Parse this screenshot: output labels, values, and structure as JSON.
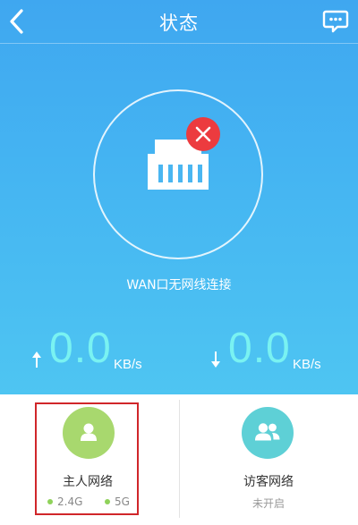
{
  "header": {
    "title": "状态",
    "back_icon": "chevron-left-icon",
    "message_icon": "chat-bubble-icon"
  },
  "wan": {
    "status_text": "WAN口无网线连接",
    "icon": "ethernet-port-icon",
    "badge_icon": "close-icon",
    "badge_color": "#ec3b3f"
  },
  "speeds": {
    "upload": {
      "value": "0.0",
      "unit": "KB/s",
      "icon": "arrow-up-icon"
    },
    "download": {
      "value": "0.0",
      "unit": "KB/s",
      "icon": "arrow-down-icon"
    }
  },
  "networks": {
    "host": {
      "title": "主人网络",
      "icon": "user-icon",
      "bands": [
        "2.4G",
        "5G"
      ],
      "band_status_color": "#8fd25a"
    },
    "guest": {
      "title": "访客网络",
      "icon": "users-icon",
      "status": "未开启"
    }
  },
  "colors": {
    "accent_blue": "#3fa7f0",
    "speed_value": "#79f2f2",
    "host_avatar": "#a8d86e",
    "guest_avatar": "#5ed0d6",
    "highlight_box": "#d0262a"
  }
}
